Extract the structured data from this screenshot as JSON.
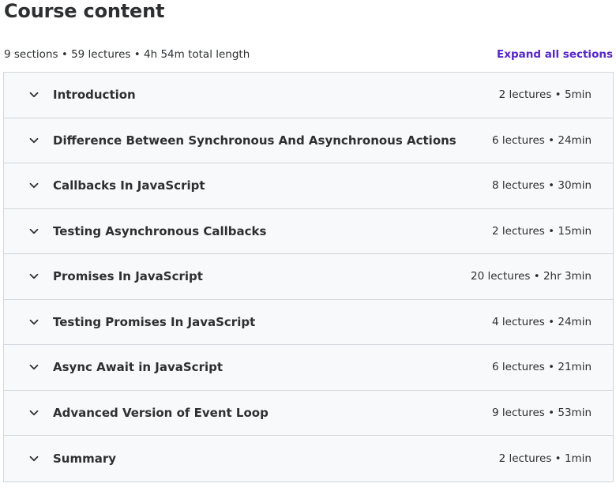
{
  "header": {
    "title": "Course content",
    "summary": "9 sections • 59 lectures • 4h 54m total length",
    "expand_label": "Expand all sections"
  },
  "sections": [
    {
      "title": "Introduction",
      "meta": "2 lectures • 5min"
    },
    {
      "title": "Difference Between Synchronous And Asynchronous Actions",
      "meta": "6 lectures • 24min"
    },
    {
      "title": "Callbacks In JavaScript",
      "meta": "8 lectures • 30min"
    },
    {
      "title": "Testing Asynchronous Callbacks",
      "meta": "2 lectures • 15min"
    },
    {
      "title": "Promises In JavaScript",
      "meta": "20 lectures • 2hr 3min"
    },
    {
      "title": "Testing Promises In JavaScript",
      "meta": "4 lectures • 24min"
    },
    {
      "title": "Async Await in JavaScript",
      "meta": "6 lectures • 21min"
    },
    {
      "title": "Advanced Version of Event Loop",
      "meta": "9 lectures • 53min"
    },
    {
      "title": "Summary",
      "meta": "2 lectures • 1min"
    }
  ],
  "icons": {
    "section_toggle": "chevron-down-icon"
  },
  "colors": {
    "text": "#2d2f31",
    "accent": "#5624d0",
    "border": "#d1d7dc",
    "section_bg": "#f7f9fa"
  }
}
